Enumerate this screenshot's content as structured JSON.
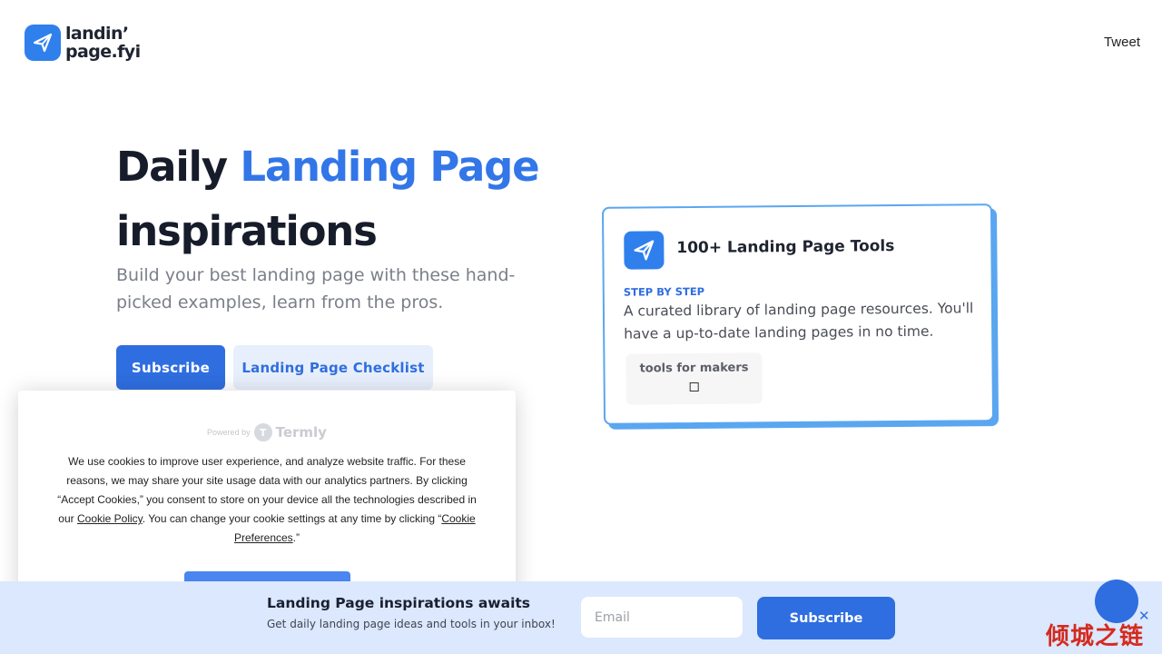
{
  "header": {
    "logo": {
      "line1": "landin’",
      "line2": "page.fyi",
      "icon": "paper-plane-icon",
      "brand_color": "#2f80ed"
    },
    "tweet_label": "Tweet"
  },
  "hero": {
    "title_part1": "Daily",
    "title_accent": "Landing Page",
    "title_part2": "inspirations",
    "subtitle": "Build your best landing page with these hand-picked examples, learn from the pros.",
    "subscribe_label": "Subscribe",
    "checklist_label": "Landing Page Checklist",
    "accent_color": "#3276e8"
  },
  "promo_card": {
    "icon": "paper-plane-icon",
    "title": "100+ Landing Page Tools",
    "kicker": "STEP BY STEP",
    "description": "A curated library of landing page resources. You'll have a up-to-date landing pages in no time.",
    "tag_label": "tools for makers"
  },
  "cookie_banner": {
    "powered_by": "Powered by",
    "provider": "Termly",
    "text_before_link1": "We use cookies to improve user experience, and analyze website traffic. For these reasons, we may share your site usage data with our analytics partners. By clicking “Accept Cookies,” you consent to store on your device all the technologies described in our ",
    "link1": "Cookie Policy",
    "text_between": ". You can change your cookie settings at any time by clicking “",
    "link2": "Cookie Preferences",
    "text_after": ".”"
  },
  "newsletter": {
    "title": "Landing Page inspirations awaits",
    "subtitle": "Get daily landing page ideas and tools in your inbox!",
    "email_placeholder": "Email",
    "subscribe_label": "Subscribe",
    "close_icon": "close-icon",
    "close_glyph": "✕"
  },
  "watermark": {
    "text": "倾城之链"
  }
}
